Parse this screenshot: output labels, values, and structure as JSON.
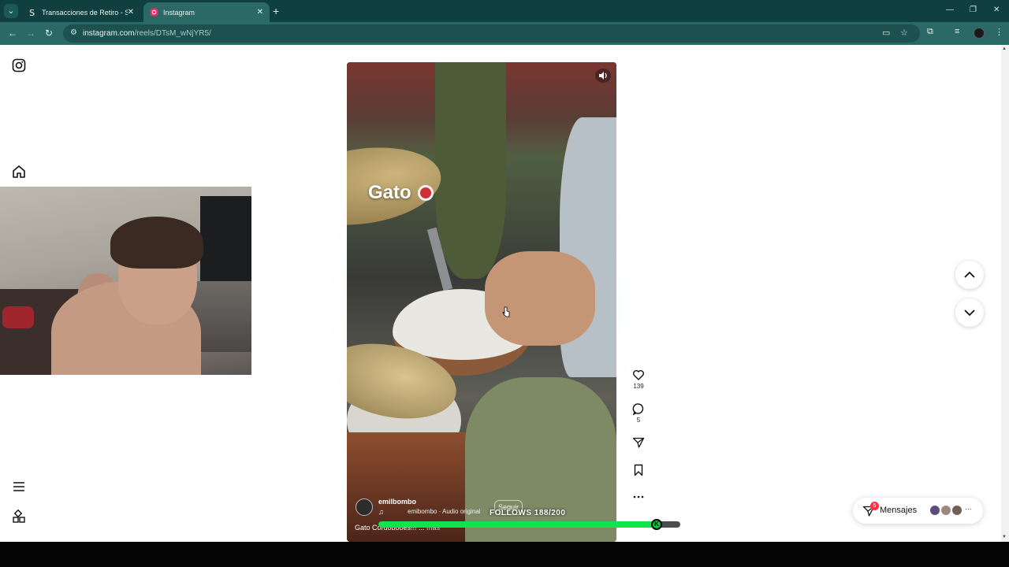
{
  "browser": {
    "tabs": [
      {
        "title": "Transacciones de Retiro - Stake",
        "active": false
      },
      {
        "title": "Instagram",
        "active": true
      }
    ],
    "url_domain": "instagram.com",
    "url_path": "/reels/DTsM_wNjYR5/"
  },
  "sidebar": {
    "icons": [
      "instagram-logo-icon",
      "home-icon",
      "menu-icon",
      "apps-icon"
    ]
  },
  "reel": {
    "title": "Gato",
    "username": "emilbombo",
    "audio": "emibombo · Audio original",
    "follow_label": "Seguir",
    "caption": "Gato Cordobooes!!! ...",
    "caption_more": "más",
    "likes": "139",
    "comments": "5"
  },
  "overlay": {
    "follows_text": "FOLLOWS 188/200",
    "follows_progress": 0.94,
    "accent_color": "#10e34c"
  },
  "messages": {
    "label": "Mensajes",
    "badge": "5"
  }
}
